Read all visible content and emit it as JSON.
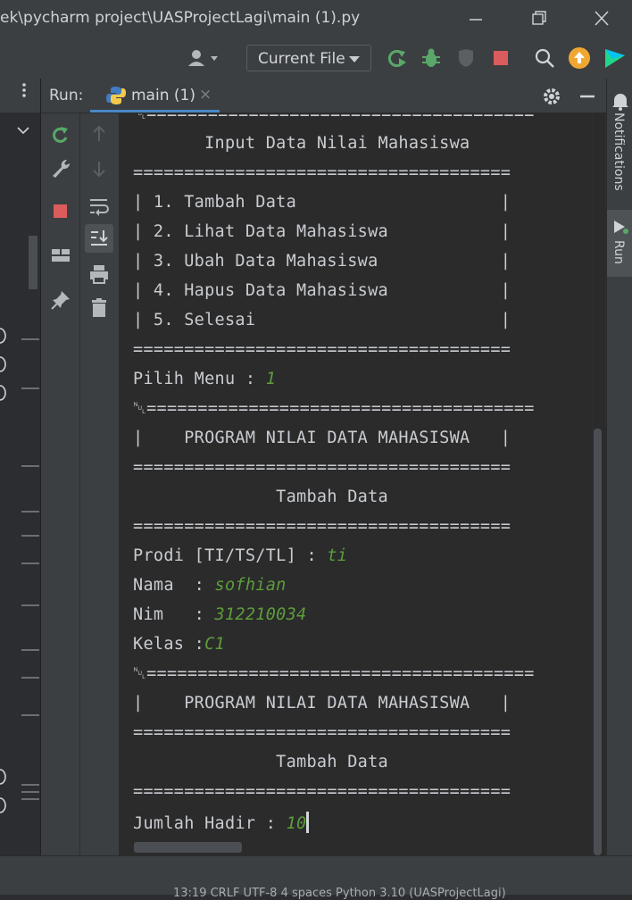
{
  "window": {
    "title": "ek\\pycharm project\\UASProjectLagi\\main (1).py"
  },
  "toolbar": {
    "run_config": "Current File"
  },
  "run_panel": {
    "label": "Run:",
    "tab_label": "main (1)"
  },
  "right_strip": {
    "notifications": "Notifications",
    "run": "Run"
  },
  "console": {
    "lines": [
      "␀======================================",
      "       Input Data Nilai Mahasiswa",
      "=====================================",
      "| 1. Tambah Data                    |",
      "| 2. Lihat Data Mahasiswa           |",
      "| 3. Ubah Data Mahasiswa            |",
      "| 4. Hapus Data Mahasiswa           |",
      "| 5. Selesai                        |",
      "=====================================",
      "Pilih Menu : ",
      "␀======================================",
      "|    PROGRAM NILAI DATA MAHASISWA   |",
      "=====================================",
      "              Tambah Data",
      "=====================================",
      "Prodi [TI/TS/TL] : ",
      "Nama  : ",
      "Nim   : ",
      "Kelas :",
      "␀======================================",
      "|    PROGRAM NILAI DATA MAHASISWA   |",
      "=====================================",
      "              Tambah Data",
      "=====================================",
      "Jumlah Hadir : "
    ],
    "inputs": {
      "pilih_menu": "1",
      "prodi": "ti",
      "nama": "sofhian",
      "nim": "312210034",
      "kelas": "C1",
      "jumlah_hadir": "10"
    }
  },
  "status": {
    "text": "13:19  CRLF  UTF-8  4 spaces  Python 3.10 (UASProjectLagi)"
  },
  "colors": {
    "accent": "#4a88c7",
    "input": "#5d9e3c",
    "run_green": "#59a869",
    "stop_red": "#db5c5c",
    "update_orange": "#f0a732"
  }
}
